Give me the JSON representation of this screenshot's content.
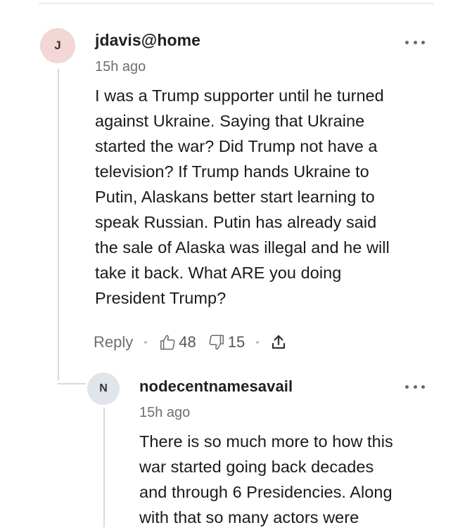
{
  "comments": [
    {
      "avatar_initial": "J",
      "avatar_color": "#f3d6d6",
      "username": "jdavis@home",
      "time": "15h ago",
      "body_lines": [
        "I was a Trump supporter until he turned",
        "against Ukraine. Saying that Ukraine",
        "started the war? Did Trump not have a",
        "television? If Trump hands Ukraine to",
        "Putin, Alaskans better start learning to",
        "speak Russian. Putin has already said",
        "the sale of Alaska was illegal and he will",
        "take it back. What ARE you doing",
        "President Trump?"
      ],
      "reply_label": "Reply",
      "likes": "48",
      "dislikes": "15",
      "icons": {
        "more": "more-horizontal-icon",
        "like": "thumbs-up-icon",
        "dislike": "thumbs-down-icon",
        "share": "share-icon"
      }
    },
    {
      "avatar_initial": "N",
      "avatar_color": "#dfe5ea",
      "username": "nodecentnamesavail",
      "time": "15h ago",
      "body_lines": [
        "There is so much more to how this",
        "war started going back decades",
        "and through 6 Presidencies. Along",
        "with that so many actors were"
      ],
      "icons": {
        "more": "more-horizontal-icon"
      }
    }
  ],
  "colors": {
    "text_primary": "#1a1a1a",
    "text_secondary": "#6f6f6f",
    "thread_line": "#d9d9d9"
  }
}
